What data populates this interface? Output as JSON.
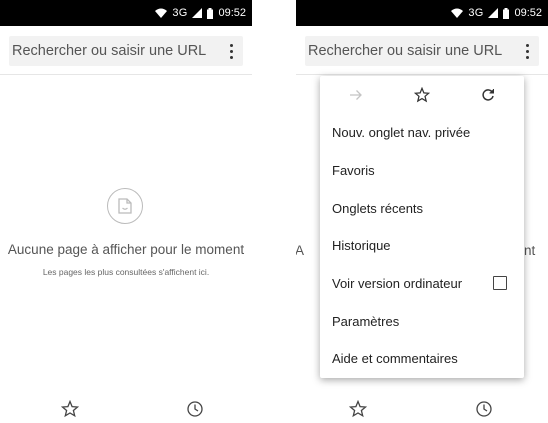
{
  "status": {
    "network": "3G",
    "time": "09:52"
  },
  "toolbar": {
    "url_placeholder": "Rechercher ou saisir une URL"
  },
  "empty_state": {
    "title": "Aucune page à afficher pour le moment",
    "subtitle": "Les pages les plus consultées s'affichent ici."
  },
  "peek": {
    "left_text": "A",
    "right_text": "nt"
  },
  "menu": {
    "items": [
      "Nouv. onglet nav. privée",
      "Favoris",
      "Onglets récents",
      "Historique",
      "Voir version ordinateur",
      "Paramètres",
      "Aide et commentaires"
    ],
    "desktop_checked": false
  },
  "colors": {
    "status_bar": "#000000",
    "url_box": "#f2f2f2",
    "accent": "#333333"
  }
}
